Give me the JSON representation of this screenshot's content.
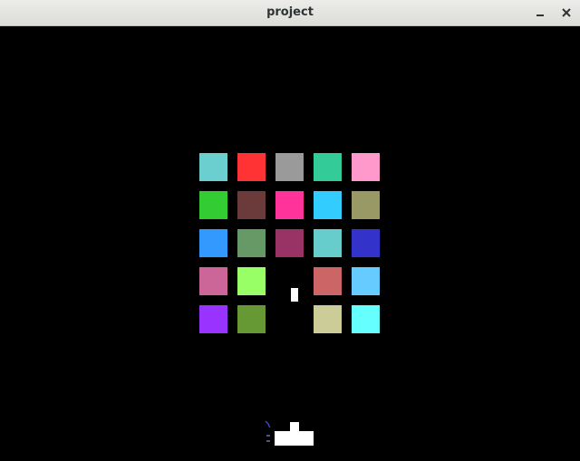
{
  "window": {
    "title": "project",
    "minimize_icon": "minimize-icon",
    "close_icon": "close-icon"
  },
  "game": {
    "background_color": "#000000",
    "brick_rows": [
      [
        "#6ccfcf",
        "#ff3333",
        "#9a9a9a",
        "#33cc99",
        "#ff99cc"
      ],
      [
        "#33cc33",
        "#6b3a3a",
        "#ff3399",
        "#33ccff",
        "#999966"
      ],
      [
        "#3399ff",
        "#669966",
        "#993366",
        "#66cccc",
        "#3333cc"
      ],
      [
        "#cc6699",
        "#99ff66",
        null,
        "#cc6666",
        "#66ccff"
      ],
      [
        "#9933ff",
        "#669933",
        null,
        "#cccc99",
        "#66ffff"
      ]
    ],
    "ball_color": "#ffffff",
    "paddle_color": "#ffffff"
  }
}
